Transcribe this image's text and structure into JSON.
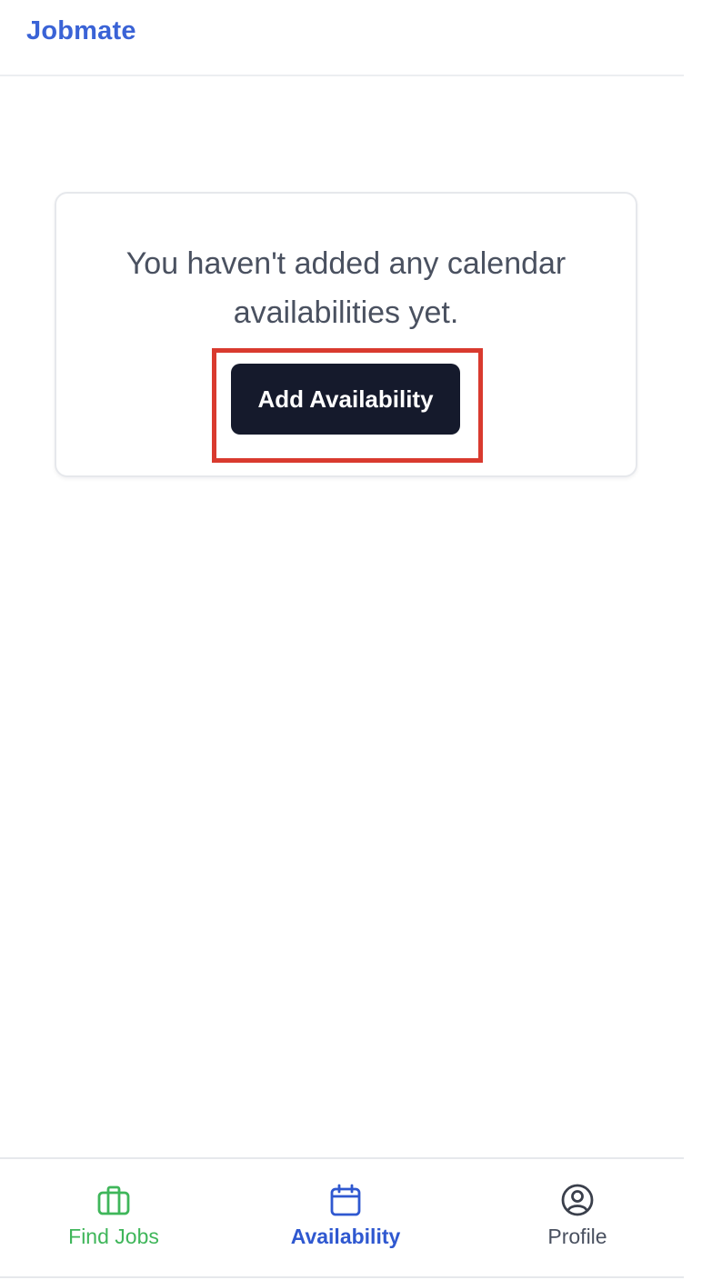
{
  "header": {
    "brand": "Jobmate"
  },
  "empty_state": {
    "message": "You haven't added any calendar availabilities yet.",
    "button_label": "Add Availability"
  },
  "bottom_nav": {
    "items": [
      {
        "label": "Find Jobs",
        "icon": "briefcase-icon",
        "color": "#3fb65a",
        "active": false
      },
      {
        "label": "Availability",
        "icon": "calendar-icon",
        "color": "#2f58d0",
        "active": true
      },
      {
        "label": "Profile",
        "icon": "user-circle-icon",
        "color": "#4a5160",
        "active": false
      }
    ]
  },
  "colors": {
    "brand": "#3a63d6",
    "button_bg": "#151a2c",
    "highlight": "#d93a2f"
  }
}
